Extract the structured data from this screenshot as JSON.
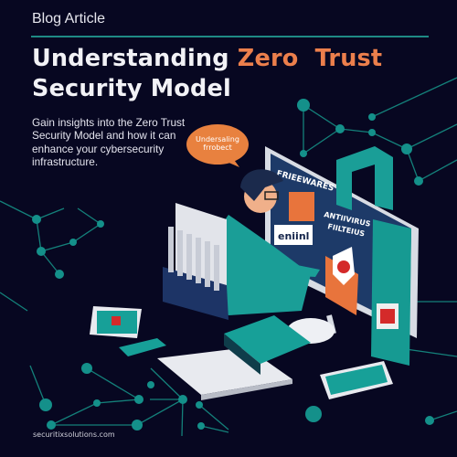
{
  "header": {
    "kicker": "Blog Article"
  },
  "title": {
    "part1": "Understanding ",
    "highlight": "Zero  Trust",
    "part2": " Security Model"
  },
  "description": "Gain insights into the Zero Trust Security Model and how it can enhance your cybersecurity infrastructure.",
  "illustration": {
    "speech_bubble": [
      "Undersaling",
      "frrobect"
    ],
    "screen_labels": [
      "FRIEEWARES",
      "ANTIIVIRUS",
      "FIILTEIUS",
      "eniinl"
    ]
  },
  "footer": {
    "website": "securitixsolutions.com"
  },
  "colors": {
    "background": "#070721",
    "accent": "#ec7f4c",
    "teal": "#1e8a84"
  }
}
